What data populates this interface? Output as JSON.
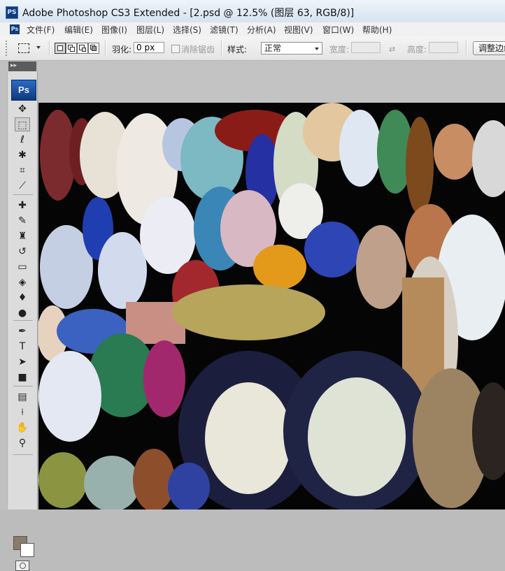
{
  "window": {
    "title": "Adobe Photoshop CS3 Extended - [2.psd @ 12.5% (图层 63, RGB/8)]",
    "app_icon": "PS"
  },
  "menu": {
    "items": [
      "文件(F)",
      "编辑(E)",
      "图像(I)",
      "图层(L)",
      "选择(S)",
      "滤镜(T)",
      "分析(A)",
      "视图(V)",
      "窗口(W)",
      "帮助(H)"
    ]
  },
  "options_bar": {
    "feather_label": "羽化:",
    "feather_value": "0 px",
    "antialias_label": "消除锯齿",
    "style_label": "样式:",
    "style_value": "正常",
    "width_label": "宽度:",
    "height_label": "高度:",
    "adjust_edge_label": "调整边缘..."
  },
  "toolbox": {
    "logo": "Ps",
    "tools": [
      {
        "name": "move-tool-icon",
        "glyph": "✥"
      },
      {
        "name": "rect-marquee-tool-icon",
        "glyph": "⬚"
      },
      {
        "name": "lasso-tool-icon",
        "glyph": "ℓ"
      },
      {
        "name": "magic-wand-tool-icon",
        "glyph": "✱"
      },
      {
        "name": "crop-tool-icon",
        "glyph": "⌗"
      },
      {
        "name": "slice-tool-icon",
        "glyph": "⟋"
      },
      {
        "name": "healing-brush-tool-icon",
        "glyph": "✚"
      },
      {
        "name": "brush-tool-icon",
        "glyph": "✎"
      },
      {
        "name": "clone-stamp-tool-icon",
        "glyph": "♜"
      },
      {
        "name": "history-brush-tool-icon",
        "glyph": "↺"
      },
      {
        "name": "eraser-tool-icon",
        "glyph": "▭"
      },
      {
        "name": "paint-bucket-tool-icon",
        "glyph": "◈"
      },
      {
        "name": "blur-tool-icon",
        "glyph": "♦"
      },
      {
        "name": "dodge-tool-icon",
        "glyph": "●"
      },
      {
        "name": "pen-tool-icon",
        "glyph": "✒"
      },
      {
        "name": "type-tool-icon",
        "glyph": "T"
      },
      {
        "name": "path-select-tool-icon",
        "glyph": "➤"
      },
      {
        "name": "shape-tool-icon",
        "glyph": "■"
      },
      {
        "name": "notes-tool-icon",
        "glyph": "▤"
      },
      {
        "name": "eyedropper-tool-icon",
        "glyph": "⟊"
      },
      {
        "name": "hand-tool-icon",
        "glyph": "✋"
      },
      {
        "name": "zoom-tool-icon",
        "glyph": "⚲"
      }
    ],
    "foreground_color": "#8a7b6a",
    "background_color": "#ffffff"
  }
}
